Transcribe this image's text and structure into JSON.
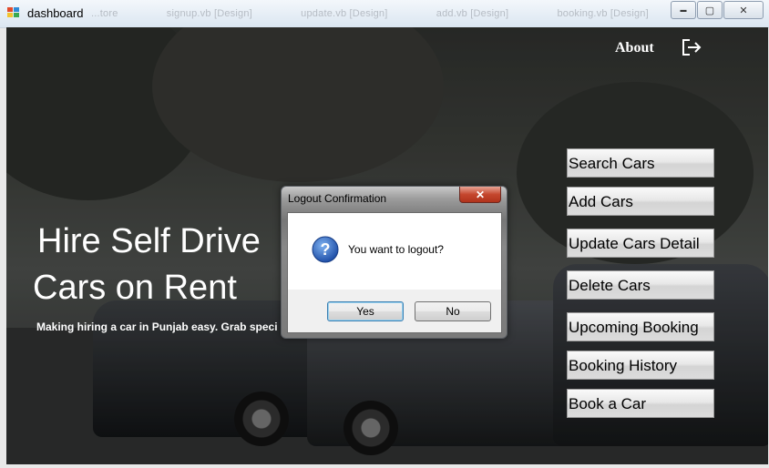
{
  "window": {
    "title": "dashboard",
    "ghost_tabs": [
      "...tore",
      "signup.vb [Design]",
      "update.vb [Design]",
      "add.vb [Design]",
      "booking.vb [Design]"
    ],
    "minimize_glyph": "▬",
    "maximize_glyph": "▢",
    "close_glyph": "✕"
  },
  "nav": {
    "about_label": "About",
    "logout_icon": "logout-icon"
  },
  "hero": {
    "line1": "Hire Self Drive",
    "line2": "Cars on Rent",
    "subtitle": "Making hiring a car in Punjab easy. Grab speci"
  },
  "menu": {
    "items": [
      {
        "label": "Search Cars"
      },
      {
        "label": "Add Cars"
      },
      {
        "label": "Update Cars Detail"
      },
      {
        "label": "Delete Cars"
      },
      {
        "label": "Upcoming Booking"
      },
      {
        "label": "Booking History"
      },
      {
        "label": "Book a Car"
      }
    ]
  },
  "dialog": {
    "title": "Logout Confirmation",
    "close_glyph": "✕",
    "icon": "question-icon",
    "message": "You want to logout?",
    "yes_label": "Yes",
    "no_label": "No"
  },
  "colors": {
    "accent_focus": "#3c7fb1",
    "close_red": "#c5472e",
    "question_blue": "#1f4fa8"
  }
}
